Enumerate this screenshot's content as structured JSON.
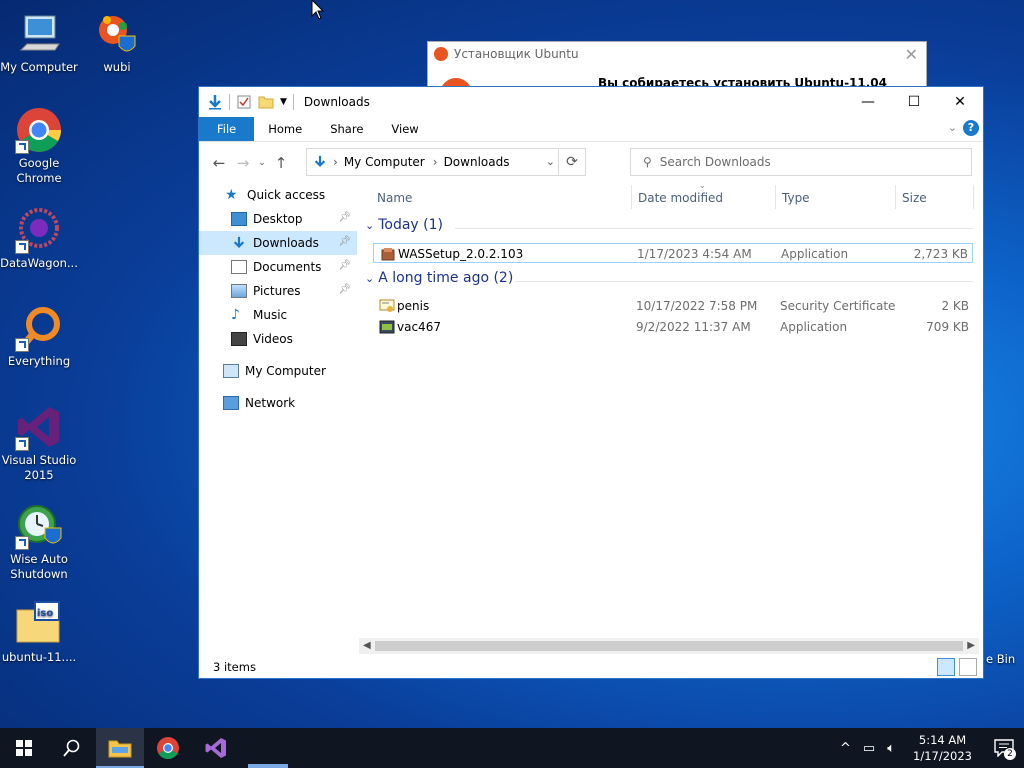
{
  "desktop": {
    "icons": [
      {
        "label": "My Computer"
      },
      {
        "label": "wubi"
      },
      {
        "label": "Google Chrome"
      },
      {
        "label": "DataWagon..."
      },
      {
        "label": "Everything"
      },
      {
        "label": "Visual Studio 2015"
      },
      {
        "label": "Wise Auto Shutdown"
      },
      {
        "label": "ubuntu-11...."
      }
    ],
    "recycle_bin_label": "e Bin"
  },
  "ubuntu_installer": {
    "title": "Установщик Ubuntu",
    "heading": "Вы собираетесь установить Ubuntu-11.04",
    "accent": "#e95420"
  },
  "explorer": {
    "title": "Downloads",
    "ribbon_tabs": [
      "File",
      "Home",
      "Share",
      "View"
    ],
    "help": "?",
    "breadcrumb": [
      "My Computer",
      "Downloads"
    ],
    "search_placeholder": "Search Downloads",
    "nav": {
      "quick_access": "Quick access",
      "items": [
        "Desktop",
        "Downloads",
        "Documents",
        "Pictures",
        "Music",
        "Videos"
      ],
      "my_computer": "My Computer",
      "network": "Network"
    },
    "columns": [
      "Name",
      "Date modified",
      "Type",
      "Size"
    ],
    "groups": [
      {
        "label": "Today (1)",
        "files": [
          {
            "name": "WASSetup_2.0.2.103",
            "date": "1/17/2023 4:54 AM",
            "type": "Application",
            "size": "2,723 KB"
          }
        ]
      },
      {
        "label": "A long time ago (2)",
        "files": [
          {
            "name": "penis",
            "date": "10/17/2022 7:58 PM",
            "type": "Security Certificate",
            "size": "2 KB"
          },
          {
            "name": "vac467",
            "date": "9/2/2022 11:37 AM",
            "type": "Application",
            "size": "709 KB"
          }
        ]
      }
    ],
    "status": "3 items",
    "accent": "#1979ca"
  },
  "taskbar": {
    "time": "5:14 AM",
    "date": "1/17/2023",
    "notification_count": "2"
  }
}
